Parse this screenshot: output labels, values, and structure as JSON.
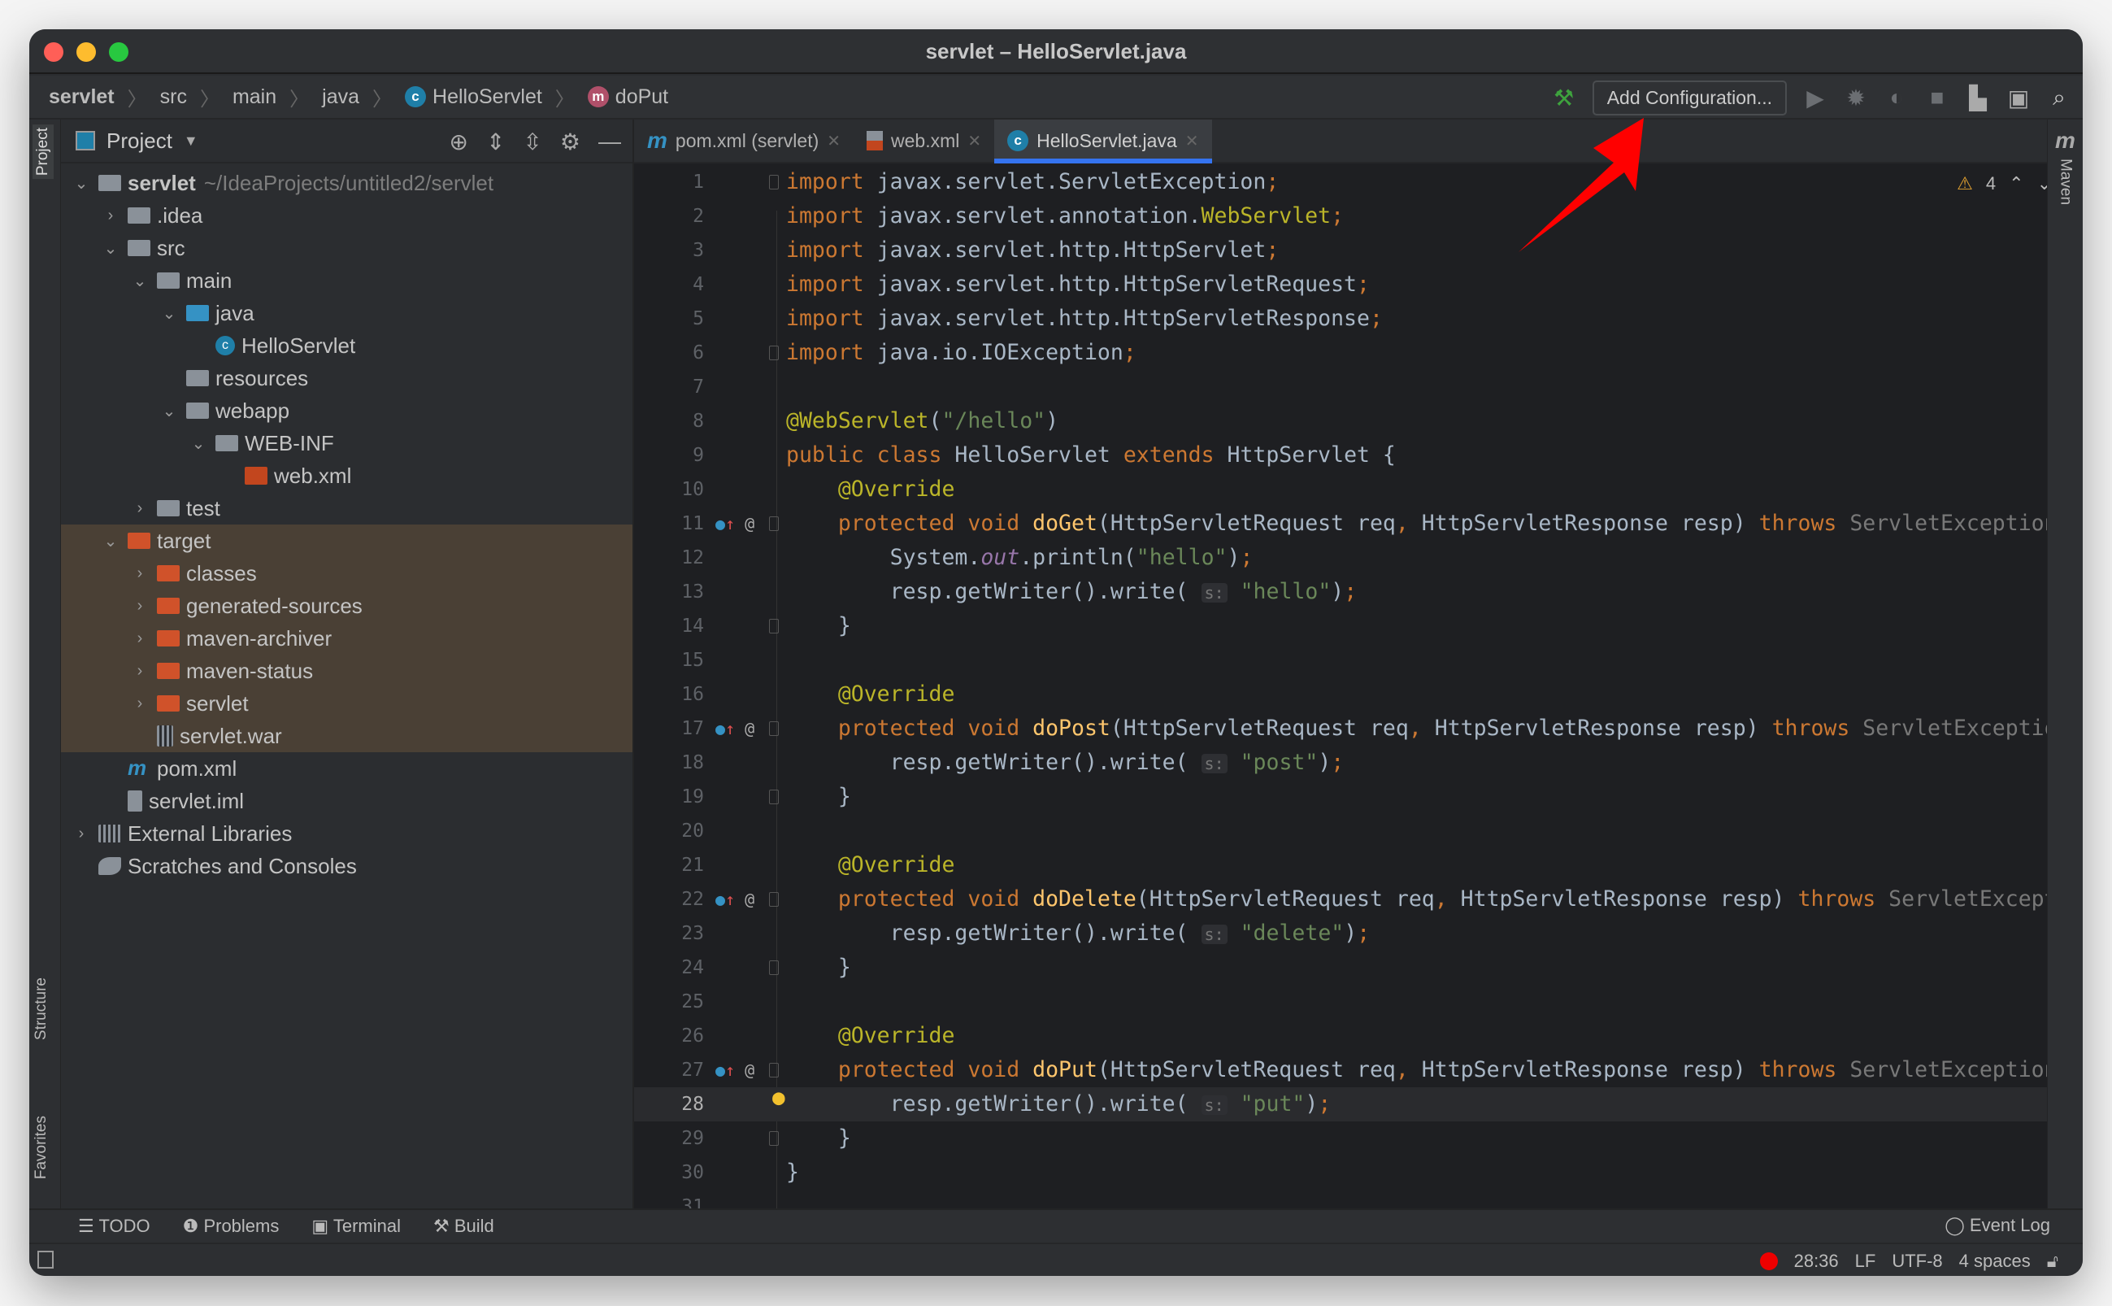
{
  "window": {
    "title": "servlet – HelloServlet.java"
  },
  "breadcrumb": [
    {
      "label": "servlet",
      "bold": true
    },
    {
      "label": "src"
    },
    {
      "label": "main"
    },
    {
      "label": "java"
    },
    {
      "label": "HelloServlet",
      "icon": "class-icon"
    },
    {
      "label": "doPut",
      "icon": "method-icon"
    }
  ],
  "toolbar": {
    "add_configuration": "Add Configuration..."
  },
  "left_stripe": {
    "project": "Project",
    "structure": "Structure",
    "favorites": "Favorites"
  },
  "right_stripe": {
    "maven": "Maven"
  },
  "project_panel": {
    "title": "Project",
    "items": [
      {
        "level": 0,
        "arrow": "open",
        "icon": "module",
        "label": "servlet",
        "extra": "~/IdeaProjects/untitled2/servlet",
        "bold": true
      },
      {
        "level": 1,
        "arrow": "closed",
        "icon": "folder",
        "label": ".idea"
      },
      {
        "level": 1,
        "arrow": "open",
        "icon": "folder",
        "label": "src"
      },
      {
        "level": 2,
        "arrow": "open",
        "icon": "folder",
        "label": "main"
      },
      {
        "level": 3,
        "arrow": "open",
        "icon": "folder-blue",
        "label": "java"
      },
      {
        "level": 4,
        "arrow": "none",
        "icon": "class",
        "label": "HelloServlet"
      },
      {
        "level": 3,
        "arrow": "none",
        "icon": "folder-res",
        "label": "resources"
      },
      {
        "level": 3,
        "arrow": "open",
        "icon": "folder",
        "label": "webapp"
      },
      {
        "level": 4,
        "arrow": "open",
        "icon": "folder",
        "label": "WEB-INF"
      },
      {
        "level": 5,
        "arrow": "none",
        "icon": "xml",
        "label": "web.xml"
      },
      {
        "level": 2,
        "arrow": "closed",
        "icon": "folder",
        "label": "test"
      },
      {
        "level": 1,
        "arrow": "open",
        "icon": "folder-orange",
        "label": "target",
        "hl": true
      },
      {
        "level": 2,
        "arrow": "closed",
        "icon": "folder-orange",
        "label": "classes",
        "hl": true
      },
      {
        "level": 2,
        "arrow": "closed",
        "icon": "folder-orange",
        "label": "generated-sources",
        "hl": true
      },
      {
        "level": 2,
        "arrow": "closed",
        "icon": "folder-orange",
        "label": "maven-archiver",
        "hl": true
      },
      {
        "level": 2,
        "arrow": "closed",
        "icon": "folder-orange",
        "label": "maven-status",
        "hl": true
      },
      {
        "level": 2,
        "arrow": "closed",
        "icon": "folder-orange",
        "label": "servlet",
        "hl": true
      },
      {
        "level": 2,
        "arrow": "none",
        "icon": "archive",
        "label": "servlet.war",
        "hl": true
      },
      {
        "level": 1,
        "arrow": "none",
        "icon": "maven",
        "label": "pom.xml"
      },
      {
        "level": 1,
        "arrow": "none",
        "icon": "iml",
        "label": "servlet.iml"
      },
      {
        "level": 0,
        "arrow": "closed",
        "icon": "libraries",
        "label": "External Libraries"
      },
      {
        "level": 0,
        "arrow": "none",
        "icon": "scratches",
        "label": "Scratches and Consoles"
      }
    ]
  },
  "tabs": [
    {
      "label": "pom.xml (servlet)",
      "icon": "maven-icon"
    },
    {
      "label": "web.xml",
      "icon": "xml-icon"
    },
    {
      "label": "HelloServlet.java",
      "icon": "class-icon",
      "active": true
    }
  ],
  "inspections": {
    "warnings": "4"
  },
  "code": {
    "current_line": 28,
    "lines": [
      [
        [
          "kw",
          "import "
        ],
        [
          "",
          "javax.servlet.ServletException"
        ],
        [
          "kw",
          ";"
        ]
      ],
      [
        [
          "kw",
          "import "
        ],
        [
          "",
          "javax.servlet.annotation."
        ],
        [
          "an",
          "WebServlet"
        ],
        [
          "kw",
          ";"
        ]
      ],
      [
        [
          "kw",
          "import "
        ],
        [
          "",
          "javax.servlet.http.HttpServlet"
        ],
        [
          "kw",
          ";"
        ]
      ],
      [
        [
          "kw",
          "import "
        ],
        [
          "",
          "javax.servlet.http.HttpServletRequest"
        ],
        [
          "kw",
          ";"
        ]
      ],
      [
        [
          "kw",
          "import "
        ],
        [
          "",
          "javax.servlet.http.HttpServletResponse"
        ],
        [
          "kw",
          ";"
        ]
      ],
      [
        [
          "kw",
          "import "
        ],
        [
          "",
          "java.io.IOException"
        ],
        [
          "kw",
          ";"
        ]
      ],
      [],
      [
        [
          "an",
          "@WebServlet"
        ],
        [
          "",
          "("
        ],
        [
          "st",
          "\"/hello\""
        ],
        [
          "",
          ")"
        ]
      ],
      [
        [
          "kw",
          "public class "
        ],
        [
          "",
          "HelloServlet "
        ],
        [
          "kw",
          "extends "
        ],
        [
          "",
          "HttpServlet {"
        ]
      ],
      [
        [
          "an",
          "    @Override"
        ]
      ],
      [
        [
          "kw",
          "    protected void "
        ],
        [
          "me",
          "doGet"
        ],
        [
          "",
          "(HttpServletRequest req"
        ],
        [
          "kw",
          ", "
        ],
        [
          "",
          "HttpServletResponse resp) "
        ],
        [
          "kw",
          "throws "
        ],
        [
          "gr",
          "ServletException"
        ],
        [
          "kw",
          ", "
        ]
      ],
      [
        [
          "",
          "        System."
        ],
        [
          "fi",
          "out"
        ],
        [
          "",
          ".println("
        ],
        [
          "st",
          "\"hello\""
        ],
        [
          "",
          ")"
        ],
        [
          "kw",
          ";"
        ]
      ],
      [
        [
          "",
          "        resp.getWriter().write( "
        ],
        [
          "hint",
          "s:"
        ],
        [
          "st",
          " \"hello\""
        ],
        [
          "",
          ")"
        ],
        [
          "kw",
          ";"
        ]
      ],
      [
        [
          "",
          "    }"
        ]
      ],
      [],
      [
        [
          "an",
          "    @Override"
        ]
      ],
      [
        [
          "kw",
          "    protected void "
        ],
        [
          "me",
          "doPost"
        ],
        [
          "",
          "(HttpServletRequest req"
        ],
        [
          "kw",
          ", "
        ],
        [
          "",
          "HttpServletResponse resp) "
        ],
        [
          "kw",
          "throws "
        ],
        [
          "gr",
          "ServletException"
        ]
      ],
      [
        [
          "",
          "        resp.getWriter().write( "
        ],
        [
          "hint",
          "s:"
        ],
        [
          "st",
          " \"post\""
        ],
        [
          "",
          ")"
        ],
        [
          "kw",
          ";"
        ]
      ],
      [
        [
          "",
          "    }"
        ]
      ],
      [],
      [
        [
          "an",
          "    @Override"
        ]
      ],
      [
        [
          "kw",
          "    protected void "
        ],
        [
          "me",
          "doDelete"
        ],
        [
          "",
          "(HttpServletRequest req"
        ],
        [
          "kw",
          ", "
        ],
        [
          "",
          "HttpServletResponse resp) "
        ],
        [
          "kw",
          "throws "
        ],
        [
          "gr",
          "ServletExcepti"
        ]
      ],
      [
        [
          "",
          "        resp.getWriter().write( "
        ],
        [
          "hint",
          "s:"
        ],
        [
          "st",
          " \"delete\""
        ],
        [
          "",
          ")"
        ],
        [
          "kw",
          ";"
        ]
      ],
      [
        [
          "",
          "    }"
        ]
      ],
      [],
      [
        [
          "an",
          "    @Override"
        ]
      ],
      [
        [
          "kw",
          "    protected void "
        ],
        [
          "me",
          "doPut"
        ],
        [
          "",
          "(HttpServletRequest req"
        ],
        [
          "kw",
          ", "
        ],
        [
          "",
          "HttpServletResponse resp) "
        ],
        [
          "kw",
          "throws "
        ],
        [
          "gr",
          "ServletException"
        ],
        [
          "kw",
          ", "
        ]
      ],
      [
        [
          "",
          "        resp.getWriter().write( "
        ],
        [
          "hint",
          "s:"
        ],
        [
          "st",
          " \"put\""
        ],
        [
          "",
          ")"
        ],
        [
          "kw",
          ";"
        ]
      ],
      [
        [
          "",
          "    }"
        ]
      ],
      [
        [
          "",
          "}"
        ]
      ],
      []
    ],
    "override_lines": [
      11,
      17,
      22,
      27
    ],
    "bulb_line": 28,
    "fold_lines": [
      1,
      6,
      11,
      14,
      17,
      19,
      22,
      24,
      27,
      29
    ]
  },
  "bottom_tools": [
    {
      "label": "TODO",
      "icon": "list-icon"
    },
    {
      "label": "Problems",
      "icon": "problems-icon"
    },
    {
      "label": "Terminal",
      "icon": "terminal-icon"
    },
    {
      "label": "Build",
      "icon": "hammer-icon"
    }
  ],
  "event_log": "Event Log",
  "status": {
    "position": "28:36",
    "line_sep": "LF",
    "encoding": "UTF-8",
    "indent": "4 spaces"
  },
  "colors": {
    "accent": "#3574f0",
    "arrow": "#ff0000",
    "keyword": "#cc7832",
    "string": "#6a8759",
    "annotation": "#bbb529"
  }
}
